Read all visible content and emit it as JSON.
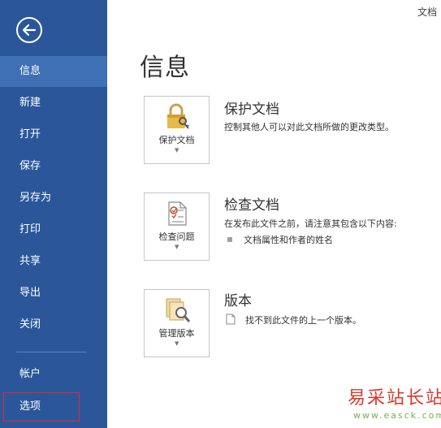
{
  "window": {
    "doc_label": "文档"
  },
  "sidebar": {
    "items": [
      {
        "label": "信息"
      },
      {
        "label": "新建"
      },
      {
        "label": "打开"
      },
      {
        "label": "保存"
      },
      {
        "label": "另存为"
      },
      {
        "label": "打印"
      },
      {
        "label": "共享"
      },
      {
        "label": "导出"
      },
      {
        "label": "关闭"
      },
      {
        "label": "帐户"
      },
      {
        "label": "选项"
      }
    ],
    "active": "信息",
    "highlighted": "选项",
    "colors": {
      "background": "#2b579a",
      "active": "#3f6fb5",
      "highlight_border": "#e0282d"
    }
  },
  "main": {
    "title": "信息",
    "sections": [
      {
        "tile_label": "保护文档",
        "title": "保护文档",
        "desc": "控制其他人可以对此文档所做的更改类型。",
        "icon": "lock-key-icon"
      },
      {
        "tile_label": "检查问题",
        "title": "检查文档",
        "desc": "在发布此文件之前，请注意其包含以下内容:",
        "sub_items": [
          "文档属性和作者的姓名"
        ],
        "icon": "inspect-document-icon"
      },
      {
        "tile_label": "管理版本",
        "title": "版本",
        "desc": "找不到此文件的上一个版本。",
        "icon": "manage-versions-icon"
      }
    ]
  },
  "watermark": {
    "text": "易采站长站",
    "url": "www.easck.com"
  }
}
